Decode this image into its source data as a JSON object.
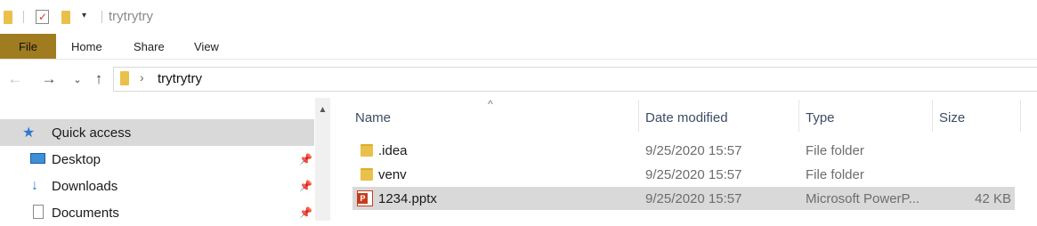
{
  "window": {
    "title": "trytrytry"
  },
  "ribbon": {
    "tabs": [
      "File",
      "Home",
      "Share",
      "View"
    ]
  },
  "address": {
    "breadcrumb": [
      "trytrytry"
    ]
  },
  "nav_pane": {
    "items": [
      {
        "label": "Quick access",
        "icon": "star-icon",
        "selected": true,
        "pinned": false
      },
      {
        "label": "Desktop",
        "icon": "desktop-icon",
        "selected": false,
        "pinned": true
      },
      {
        "label": "Downloads",
        "icon": "download-icon",
        "selected": false,
        "pinned": true
      },
      {
        "label": "Documents",
        "icon": "documents-icon",
        "selected": false,
        "pinned": true
      }
    ]
  },
  "file_list": {
    "columns": [
      "Name",
      "Date modified",
      "Type",
      "Size"
    ],
    "rows": [
      {
        "name": ".idea",
        "date": "9/25/2020 15:57",
        "type": "File folder",
        "size": "",
        "icon": "folder-icon",
        "selected": false
      },
      {
        "name": "venv",
        "date": "9/25/2020 15:57",
        "type": "File folder",
        "size": "",
        "icon": "folder-icon",
        "selected": false
      },
      {
        "name": "1234.pptx",
        "date": "9/25/2020 15:57",
        "type": "Microsoft PowerP...",
        "size": "42 KB",
        "icon": "powerpoint-file-icon",
        "selected": true
      }
    ]
  },
  "colors": {
    "file_tab": "#a07c20",
    "folder": "#e9c04a",
    "selection": "#d9d9d9",
    "quick_access_star": "#2b78d4"
  }
}
